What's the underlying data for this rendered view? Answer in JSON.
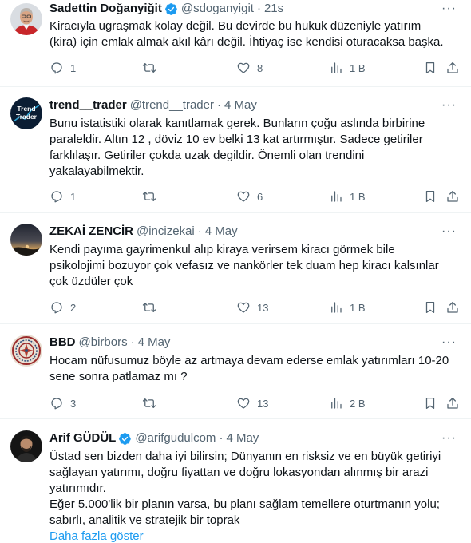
{
  "tweets": [
    {
      "name": "Sadettin Doğanyiğit",
      "verified": true,
      "handle": "@sdoganyigit",
      "time": "21s",
      "text": "Kiracıyla ugraşmak kolay değil. Bu devirde bu hukuk düzeniyle yatırım (kira) için emlak almak akıl kârı değil. İhtiyaç ise kendisi oturacaksa başka.",
      "replies": "1",
      "retweets": "",
      "likes": "8",
      "views": "1 B",
      "avatar": "person-red-shirt"
    },
    {
      "name": "trend__trader",
      "verified": false,
      "handle": "@trend__trader",
      "time": "4 May",
      "text": "Bunu istatistiki olarak kanıtlamak gerek. Bunların çoğu aslında birbirine paraleldir. Altın 12 , döviz 10 ev belki 13 kat artırmıştır. Sadece getiriler farklılaşır. Getiriler çokda uzak degildir. Önemli olan trendini yakalayabilmektir.",
      "replies": "1",
      "retweets": "",
      "likes": "6",
      "views": "1 B",
      "avatar": "trend-trader-logo",
      "avatar_text_1": "Trend",
      "avatar_text_2": "Trader"
    },
    {
      "name": "ZEKAİ ZENCİR",
      "verified": false,
      "handle": "@incizekai",
      "time": "4 May",
      "text": "Kendi payıma gayrimenkul alıp kiraya verirsem  kiracı görmek bile psikolojimi bozuyor çok vefasız ve nankörler tek duam hep kiracı kalsınlar çok üzdüler çok",
      "replies": "2",
      "retweets": "",
      "likes": "13",
      "views": "1 B",
      "avatar": "sunset-landscape"
    },
    {
      "name": "BBD",
      "verified": false,
      "handle": "@birbors",
      "time": "4 May",
      "text": "Hocam nüfusumuz böyle az artmaya devam ederse emlak yatırımları 10-20 sene sonra patlamaz mı ?",
      "replies": "3",
      "retweets": "",
      "likes": "13",
      "views": "2 B",
      "avatar": "ornamental-pattern"
    },
    {
      "name": "Arif GÜDÜL",
      "verified": true,
      "handle": "@arifgudulcom",
      "time": "4 May",
      "text": "Üstad sen bizden daha iyi bilirsin; Dünyanın en risksiz ve en büyük getiriyi sağlayan yatırımı, doğru fiyattan ve doğru lokasyondan alınmış bir arazi yatırımıdır.\nEğer 5.000'lik bir planın varsa, bu planı sağlam temellere oturtmanın yolu; sabırlı, analitik ve stratejik bir toprak",
      "show_more": "Daha fazla göster",
      "avatar": "person-dark-background"
    }
  ],
  "colors": {
    "accent": "#1d9bf0",
    "muted": "#536471",
    "text": "#0f1419",
    "divider": "#eff3f4"
  },
  "icons": [
    "reply-icon",
    "retweet-icon",
    "like-icon",
    "views-icon",
    "bookmark-icon",
    "share-icon",
    "more-icon",
    "verified-badge-icon"
  ]
}
